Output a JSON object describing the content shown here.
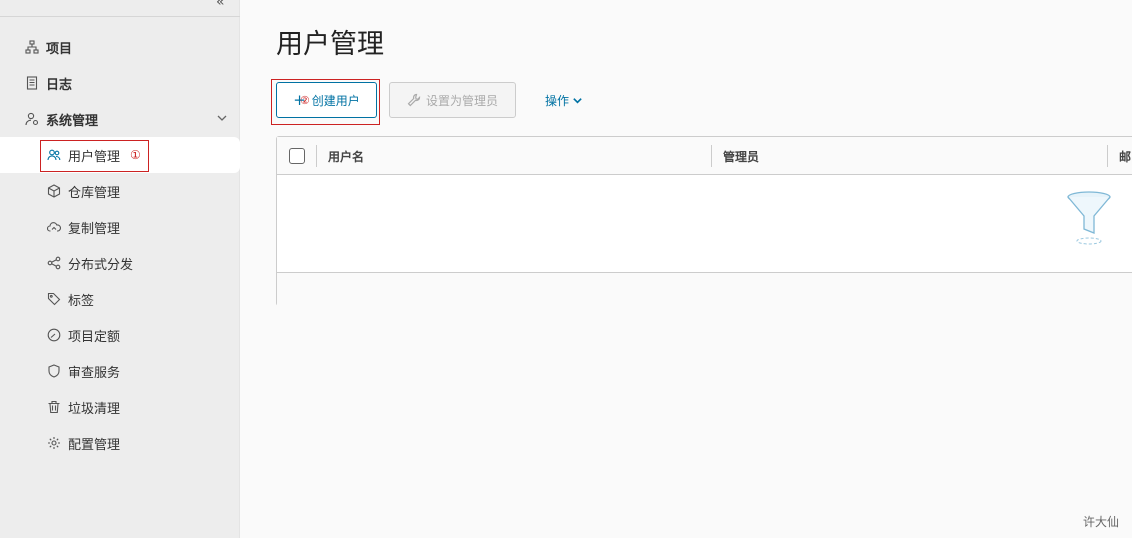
{
  "sidebar": {
    "collapse_label": "«",
    "items": [
      {
        "label": "项目",
        "icon": "project-tree-icon"
      },
      {
        "label": "日志",
        "icon": "log-document-icon"
      },
      {
        "label": "系统管理",
        "icon": "user-gear-icon"
      }
    ],
    "sub_items": [
      {
        "label": "用户管理",
        "icon": "users-icon",
        "active": true
      },
      {
        "label": "仓库管理",
        "icon": "box-icon"
      },
      {
        "label": "复制管理",
        "icon": "cloud-sync-icon"
      },
      {
        "label": "分布式分发",
        "icon": "share-nodes-icon"
      },
      {
        "label": "标签",
        "icon": "tag-icon"
      },
      {
        "label": "项目定额",
        "icon": "gauge-icon"
      },
      {
        "label": "审查服务",
        "icon": "shield-icon"
      },
      {
        "label": "垃圾清理",
        "icon": "trash-icon"
      },
      {
        "label": "配置管理",
        "icon": "gear-icon"
      }
    ],
    "annotation_1": "①"
  },
  "main": {
    "title": "用户管理",
    "buttons": {
      "create_plus": "+",
      "create_label": "创建用户",
      "create_annotation": "②",
      "admin_label": "设置为管理员",
      "ops_label": "操作"
    },
    "grid": {
      "columns": [
        "用户名",
        "管理员",
        "邮"
      ]
    }
  },
  "watermark": "许大仙",
  "colors": {
    "accent": "#0072a3",
    "annotation_red": "#cc2222",
    "sidebar_bg": "#ededed"
  }
}
